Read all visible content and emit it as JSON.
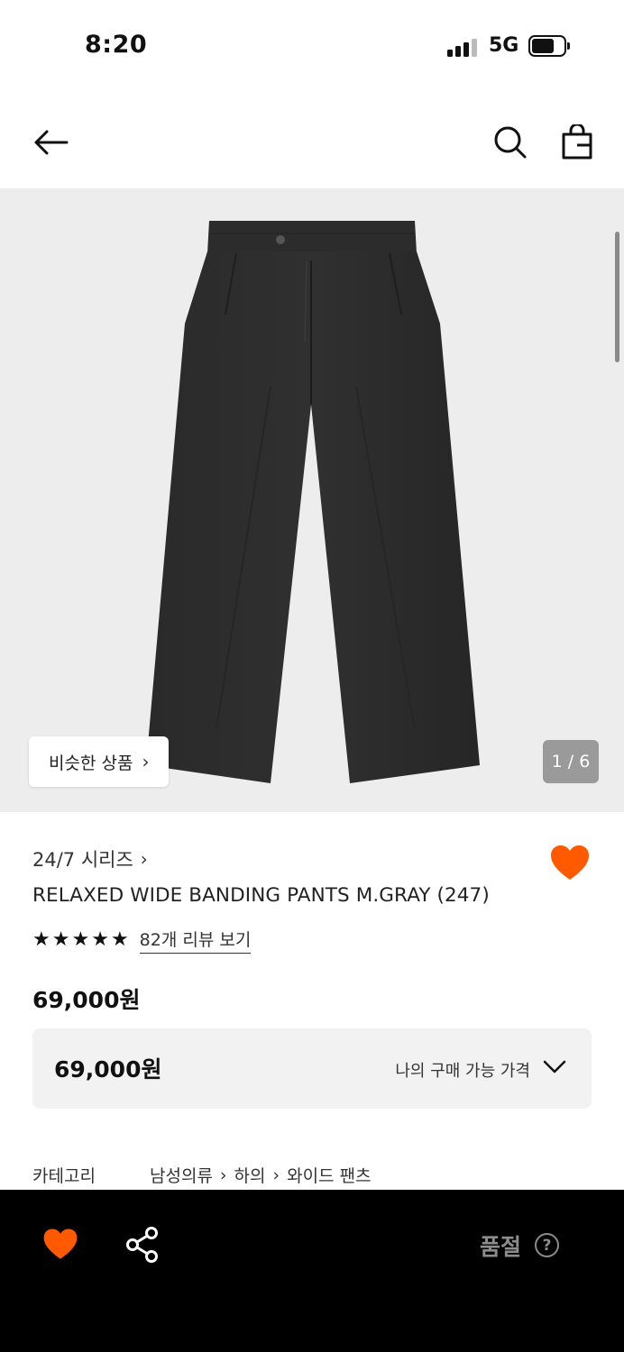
{
  "status_bar": {
    "time": "8:20",
    "network": "5G"
  },
  "nav": {
    "back_icon": "arrow-left-icon",
    "search_icon": "search-icon",
    "cart_icon": "shopping-bag-icon"
  },
  "gallery": {
    "similar_button": "비슷한 상품",
    "page_indicator": "1 / 6"
  },
  "product": {
    "series": "24/7 시리즈",
    "name": "RELAXED WIDE BANDING PANTS M.GRAY (247)",
    "rating_stars": 5,
    "review_link": "82개 리뷰 보기",
    "price": "69,000원",
    "wishlisted": true
  },
  "price_box": {
    "amount": "69,000원",
    "label": "나의 구매 가능 가격"
  },
  "category": {
    "label": "카테고리",
    "crumbs": [
      "남성의류",
      "하의",
      "와이드 팬츠"
    ]
  },
  "bottom_bar": {
    "status": "품절",
    "help": "?"
  },
  "colors": {
    "accent": "#ff5a00",
    "bottom_bar_bg": "#000000",
    "soldout_text": "#8c8c8c",
    "image_bg": "#ededed"
  }
}
